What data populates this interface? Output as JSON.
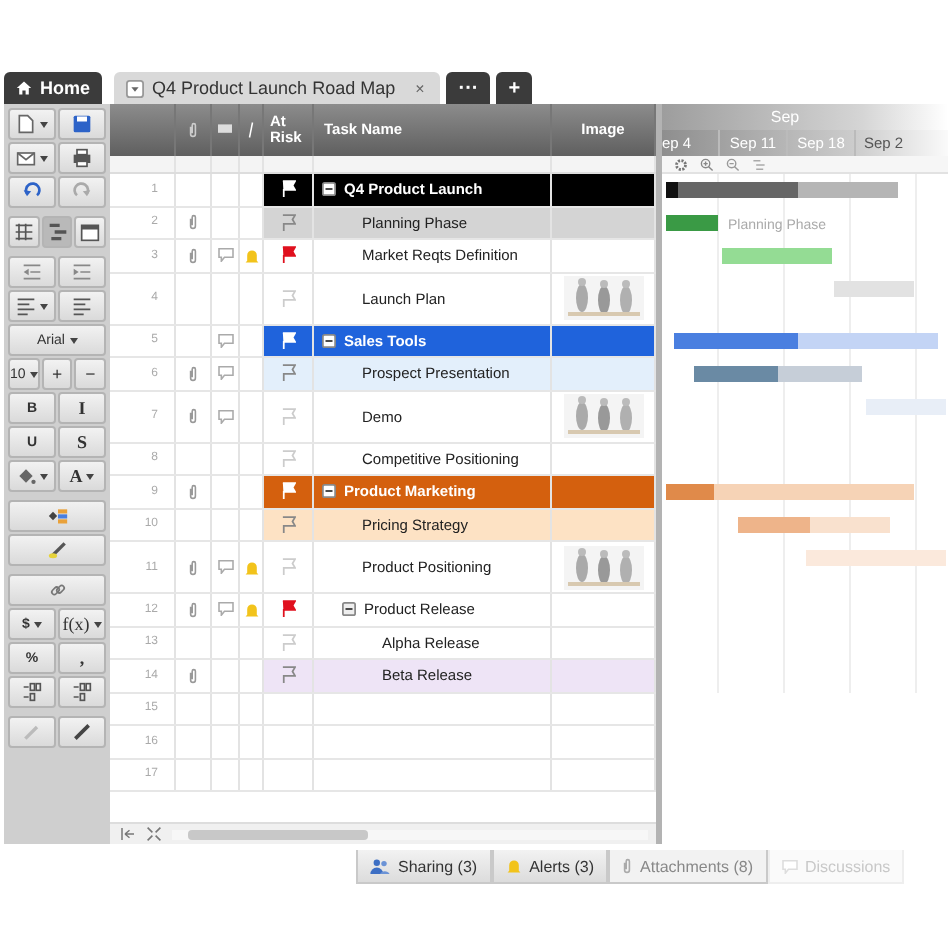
{
  "tabs": [
    {
      "label": "Home",
      "kind": "home",
      "selected": false
    },
    {
      "label": "Q4 Product Launch Road Map",
      "kind": "sheet",
      "close": "×",
      "selected": true
    },
    {
      "label": "···",
      "kind": "more",
      "selected": false
    },
    {
      "label": "+",
      "kind": "add",
      "selected": false
    }
  ],
  "toolbar": [
    [
      [
        {
          "kind": "icon",
          "dropdown": true
        },
        {
          "kind": "icon"
        }
      ],
      [
        {
          "kind": "icon",
          "dropdown": true
        },
        {
          "kind": "icon"
        }
      ],
      [
        {
          "kind": "icon"
        },
        {
          "kind": "icon"
        }
      ]
    ],
    [
      [
        {
          "kind": "icon",
          "selected": false
        },
        {
          "kind": "icon",
          "selected": true
        },
        {
          "kind": "icon",
          "selected": false
        }
      ]
    ],
    [
      [
        {
          "kind": "icon"
        },
        {
          "kind": "icon"
        }
      ],
      [
        {
          "kind": "icon",
          "dropdown": true
        },
        {
          "kind": "icon"
        }
      ],
      [
        {
          "kind": "text",
          "label": "Arial",
          "dropdown": true
        }
      ],
      [
        {
          "kind": "text",
          "label": "10",
          "dropdown": true
        },
        {
          "kind": "text",
          "label": "+"
        },
        {
          "kind": "text",
          "label": "−"
        }
      ],
      [
        {
          "kind": "text",
          "label": "B"
        },
        {
          "kind": "text",
          "label": "I"
        }
      ],
      [
        {
          "kind": "text",
          "label": "U"
        },
        {
          "kind": "text",
          "label": "S"
        }
      ],
      [
        {
          "kind": "icon",
          "dropdown": true
        },
        {
          "kind": "text",
          "label": "A",
          "dropdown": true
        }
      ]
    ],
    [
      [
        {
          "kind": "icon"
        }
      ],
      [
        {
          "kind": "icon"
        }
      ]
    ],
    [
      [
        {
          "kind": "icon"
        }
      ],
      [
        {
          "kind": "text",
          "label": "$",
          "dropdown": true
        },
        {
          "kind": "text",
          "label": "f(x)",
          "dropdown": true
        }
      ],
      [
        {
          "kind": "text",
          "label": "%"
        },
        {
          "kind": "text",
          "label": ","
        }
      ],
      [
        {
          "kind": "icon"
        },
        {
          "kind": "icon"
        }
      ]
    ],
    [
      [
        {
          "kind": "icon"
        },
        {
          "kind": "icon"
        }
      ]
    ]
  ],
  "columns": [
    {
      "kind": "attachment"
    },
    {
      "kind": "comment"
    },
    {
      "kind": "alert"
    },
    {
      "kind": "flag",
      "label": "At Risk"
    },
    {
      "kind": "task",
      "label": "Task Name"
    },
    {
      "label": "Image"
    }
  ],
  "gantt": {
    "month": "Sep",
    "weeks": [
      "ep 4",
      "Sep 11",
      "Sep 18",
      "Sep 2"
    ]
  },
  "rows": [
    {
      "num": "1",
      "task": "Q4 Product Launch",
      "kind": "section",
      "color": "#000000",
      "expanded": true,
      "at_risk": false,
      "attachment": false,
      "comment": false,
      "alert": false,
      "image": false,
      "children": [
        {
          "num": "2",
          "task": "Planning Phase",
          "kind": "task",
          "color": "#d4d4d4",
          "bar_label": "Planning Phase",
          "at_risk": false,
          "attachment": true,
          "comment": false,
          "alert": false,
          "image": false
        },
        {
          "num": "3",
          "task": "Market Reqts Definition",
          "kind": "task",
          "at_risk": true,
          "attachment": true,
          "comment": true,
          "alert": true,
          "image": false
        },
        {
          "num": "4",
          "task": "Launch Plan",
          "kind": "task",
          "at_risk": false,
          "attachment": false,
          "comment": false,
          "alert": false,
          "image": true
        }
      ]
    },
    {
      "num": "5",
      "task": "Sales Tools",
      "kind": "section",
      "color": "#1f63dc",
      "expanded": true,
      "at_risk": false,
      "attachment": false,
      "comment": true,
      "alert": false,
      "image": false,
      "children": [
        {
          "num": "6",
          "task": "Prospect Presentation",
          "kind": "task",
          "color": "#e3effb",
          "at_risk": false,
          "attachment": true,
          "comment": true,
          "alert": false,
          "image": false
        },
        {
          "num": "7",
          "task": "Demo",
          "kind": "task",
          "at_risk": false,
          "attachment": true,
          "comment": true,
          "alert": false,
          "image": true
        },
        {
          "num": "8",
          "task": "Competitive Positioning",
          "kind": "task",
          "at_risk": false,
          "attachment": false,
          "comment": false,
          "alert": false,
          "image": false
        }
      ]
    },
    {
      "num": "9",
      "task": "Product Marketing",
      "kind": "section",
      "color": "#d4600e",
      "expanded": true,
      "at_risk": false,
      "attachment": true,
      "comment": false,
      "alert": false,
      "image": false,
      "children": [
        {
          "num": "10",
          "task": "Pricing Strategy",
          "kind": "task",
          "color": "#fde2c4",
          "at_risk": false,
          "attachment": false,
          "comment": false,
          "alert": false,
          "image": false
        },
        {
          "num": "11",
          "task": "Product Positioning",
          "kind": "task",
          "at_risk": false,
          "attachment": true,
          "comment": true,
          "alert": true,
          "image": true
        },
        {
          "num": "12",
          "task": "Product Release",
          "kind": "task",
          "expanded": true,
          "at_risk": true,
          "attachment": true,
          "comment": true,
          "alert": true,
          "image": false,
          "children": [
            {
              "num": "13",
              "task": "Alpha Release",
              "kind": "task",
              "at_risk": false,
              "attachment": false,
              "comment": false,
              "alert": false,
              "image": false
            },
            {
              "num": "14",
              "task": "Beta Release",
              "kind": "task",
              "color": "#eee4f6",
              "at_risk": false,
              "attachment": true,
              "comment": false,
              "alert": false,
              "image": false
            }
          ]
        }
      ]
    }
  ],
  "empty_rows": [
    "15",
    "16",
    "17"
  ],
  "panel_tabs": [
    {
      "label": "Sharing (3)",
      "kind": "sharing"
    },
    {
      "label": "Alerts (3)",
      "kind": "alerts"
    },
    {
      "label": "Attachments (8)",
      "kind": "attachments"
    },
    {
      "label": "Discussions",
      "kind": "discussions"
    }
  ]
}
